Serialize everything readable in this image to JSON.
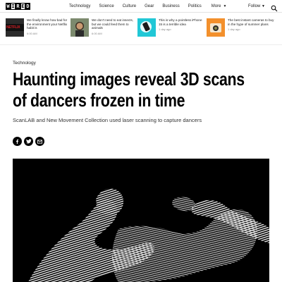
{
  "brand": {
    "logo_letters": [
      "W",
      "I",
      "R",
      "E",
      "D"
    ]
  },
  "nav": {
    "items": [
      "Technology",
      "Science",
      "Culture",
      "Gear",
      "Business",
      "Politics"
    ],
    "more_label": "More",
    "follow_label": "Follow"
  },
  "trending": [
    {
      "title": "We finally know how bad for the environment your Netflix habit is",
      "meta": "6:00 AM",
      "thumb_text": "NETFLIX"
    },
    {
      "title": "We don't need to eat insects, but we could feed them to animals",
      "meta": "6:00 AM"
    },
    {
      "title": "This is why a pointless iPhone 15 is a terrible idea",
      "meta": "1 day ago"
    },
    {
      "title": "The best instant cameras to buy in the hype of summer plans",
      "meta": "1 day ago"
    }
  ],
  "article": {
    "category": "Technology",
    "headline_line1": "Haunting images reveal 3D scans",
    "headline_line2": "of dancers frozen in time",
    "dek": "ScanLAB and New Movement Collection used laser scanning to capture dancers"
  },
  "share": [
    "facebook",
    "twitter",
    "email"
  ],
  "colors": {
    "netflix_red": "#d81f26",
    "thumb_orange": "#f3902c",
    "thumb_cyan": "#21c7d6",
    "thumb_olive": "#8a8a4a"
  }
}
